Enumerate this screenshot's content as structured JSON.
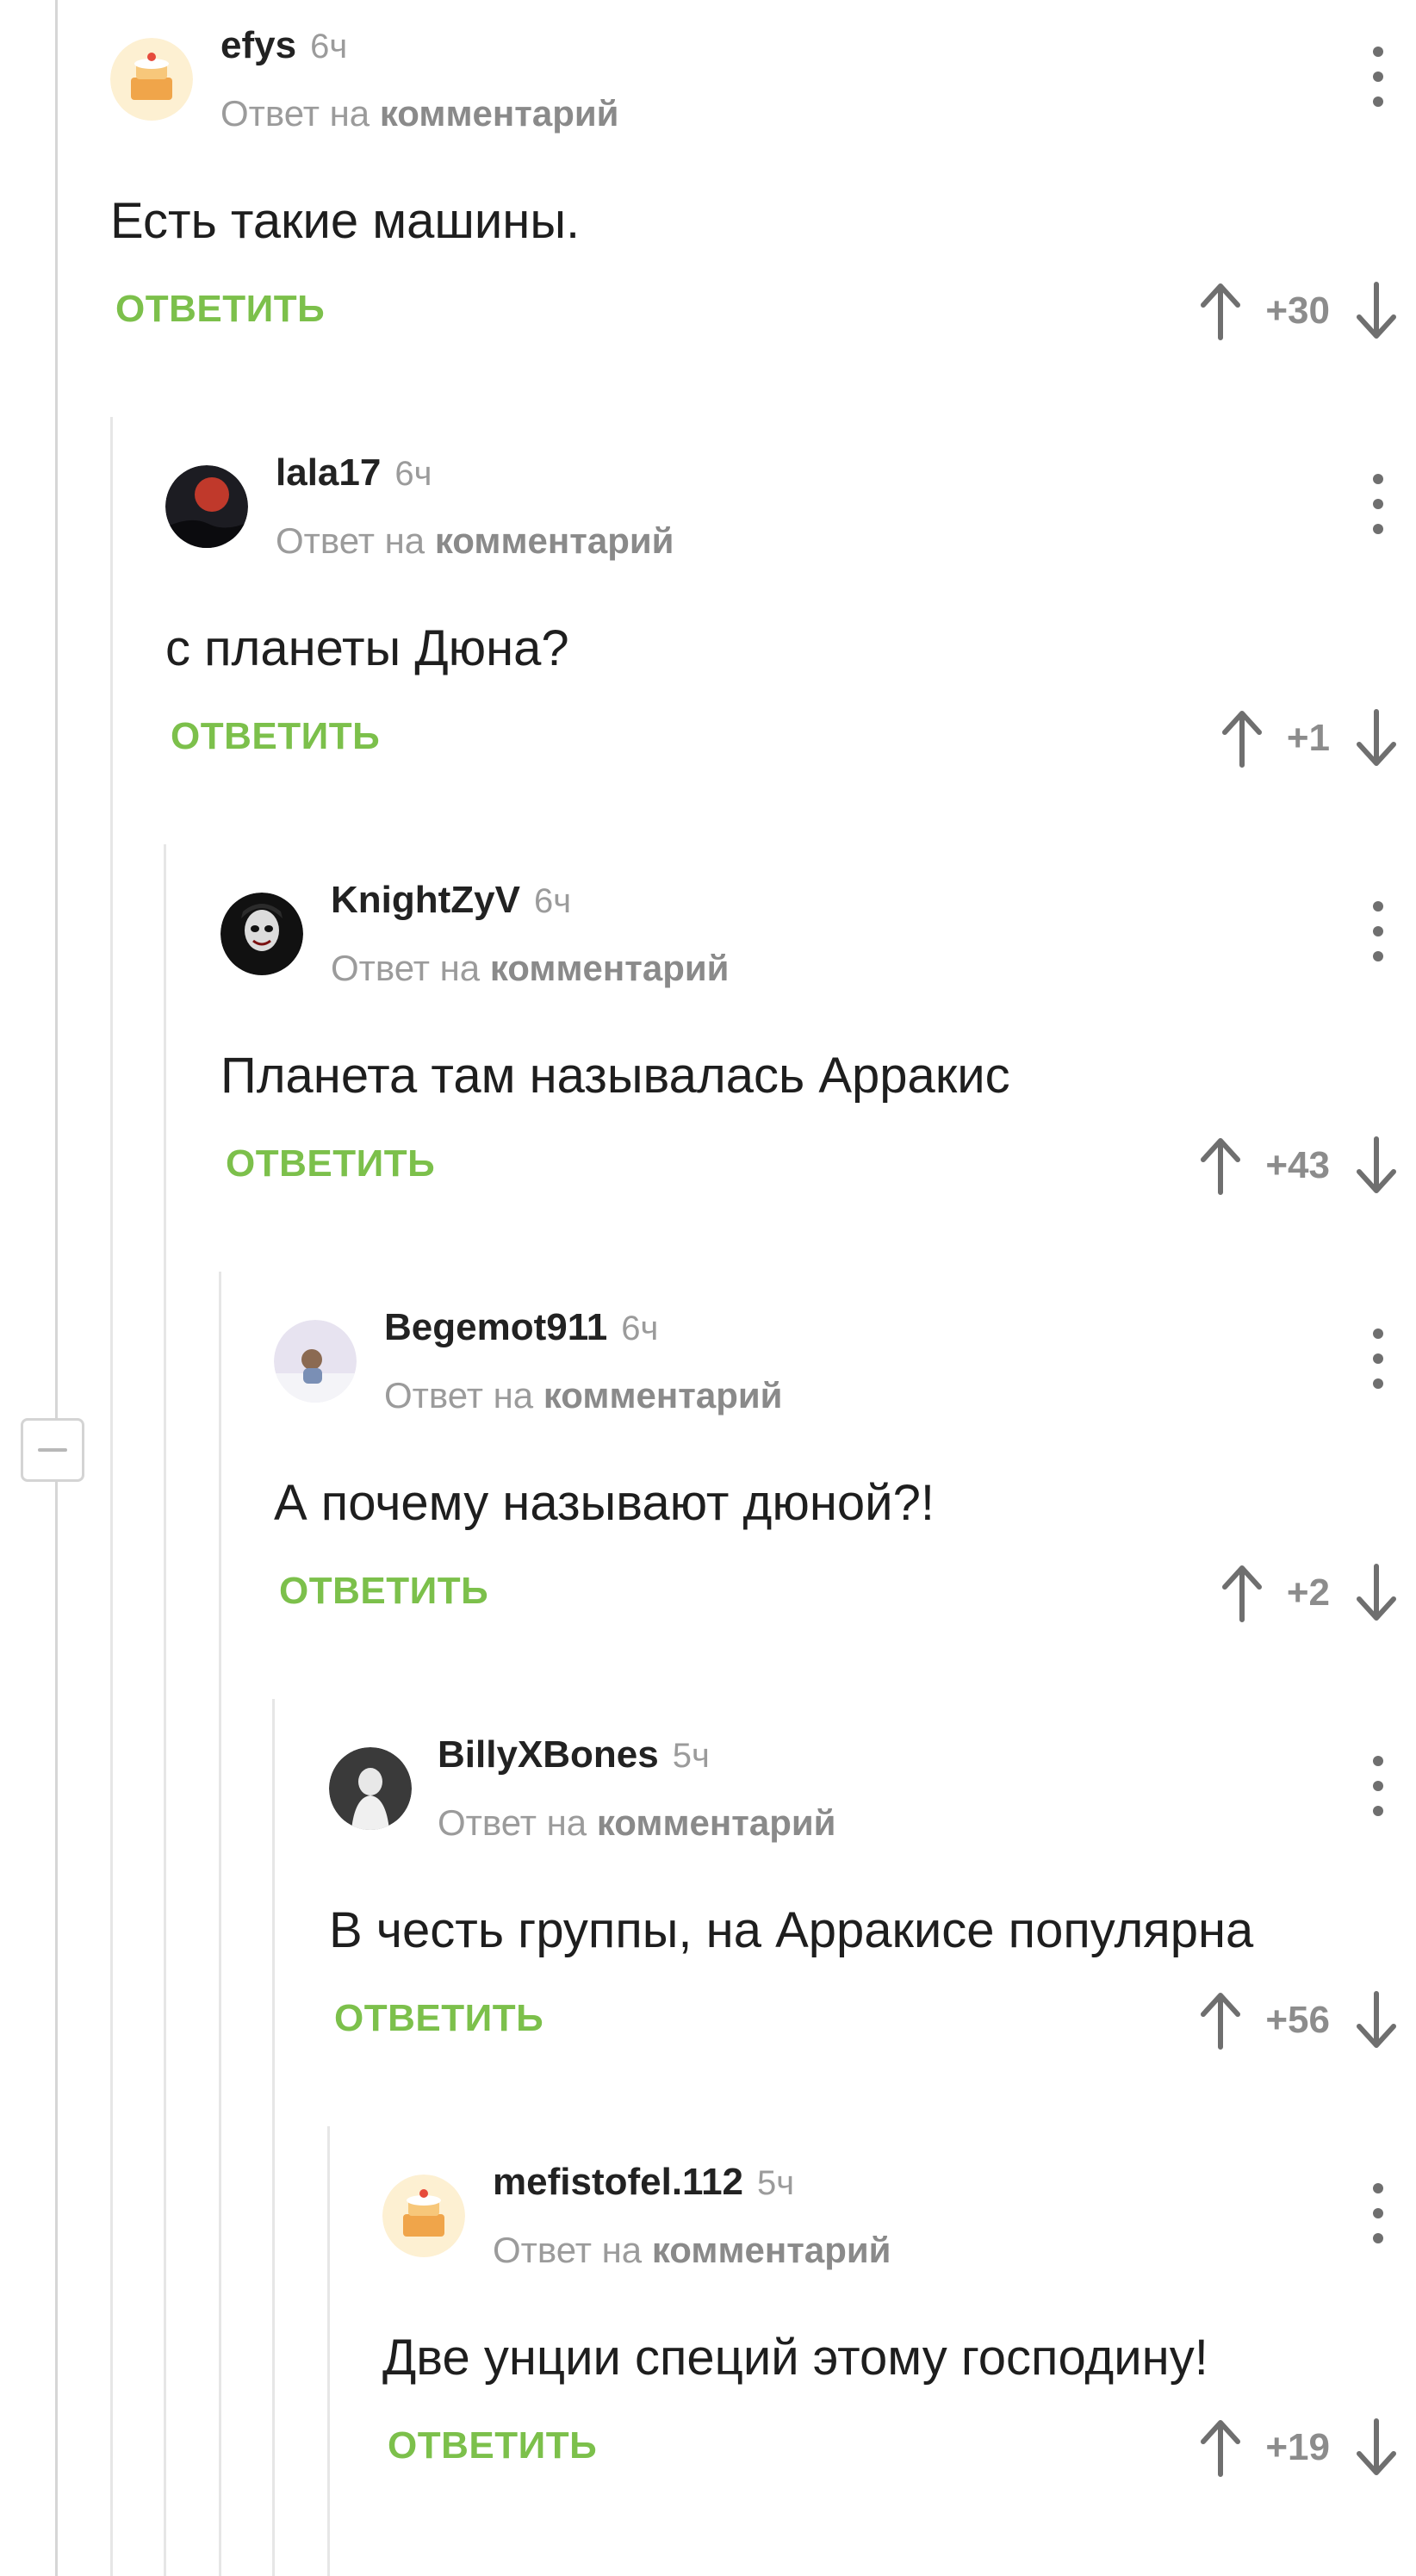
{
  "comments": [
    {
      "username": "efys",
      "time": "6ч",
      "reply_prefix": "Ответ на",
      "reply_link": "комментарий",
      "text": "Есть такие машины.",
      "reply_label": "ОТВЕТИТЬ",
      "score": "+30",
      "avatar": "pikabu-cake-avatar"
    },
    {
      "username": "lala17",
      "time": "6ч",
      "reply_prefix": "Ответ на",
      "reply_link": "комментарий",
      "text": "с планеты Дюна?",
      "reply_label": "ОТВЕТИТЬ",
      "score": "+1",
      "avatar": "red-moon-avatar"
    },
    {
      "username": "KnightZyV",
      "time": "6ч",
      "reply_prefix": "Ответ на",
      "reply_link": "комментарий",
      "text": "Планета там называлась Арракис",
      "reply_label": "ОТВЕТИТЬ",
      "score": "+43",
      "avatar": "joker-avatar"
    },
    {
      "username": "Begemot911",
      "time": "6ч",
      "reply_prefix": "Ответ на",
      "reply_link": "комментарий",
      "text": "А почему называют дюной?!",
      "reply_label": "ОТВЕТИТЬ",
      "score": "+2",
      "avatar": "winter-scene-avatar"
    },
    {
      "username": "BillyXBones",
      "time": "5ч",
      "reply_prefix": "Ответ на",
      "reply_link": "комментарий",
      "text": "В честь группы, на Арракисе популярна",
      "reply_label": "ОТВЕТИТЬ",
      "score": "+56",
      "avatar": "bw-figure-avatar"
    },
    {
      "username": "mefistofel.112",
      "time": "5ч",
      "reply_prefix": "Ответ на",
      "reply_link": "комментарий",
      "text": "Две унции специй этому господину!",
      "reply_label": "ОТВЕТИТЬ",
      "score": "+19",
      "avatar": "pikabu-cake-avatar"
    }
  ],
  "colors": {
    "reply_green": "#7cc04b",
    "username": "#222222",
    "muted": "#9b9b9b",
    "thread_line": "#e6e6e6"
  },
  "icons": {
    "upvote": "arrow-up-icon",
    "downvote": "arrow-down-icon",
    "menu": "more-vertical-icon",
    "collapse": "collapse-thread-icon"
  }
}
